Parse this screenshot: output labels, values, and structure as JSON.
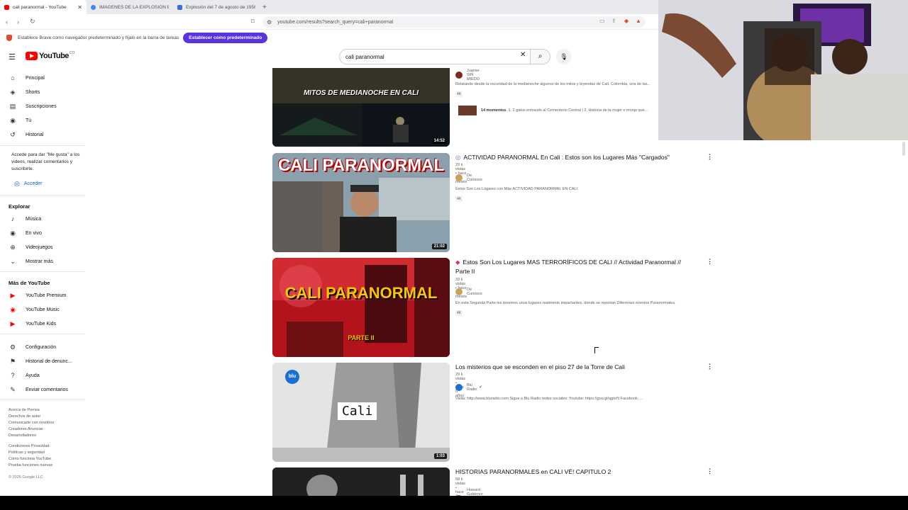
{
  "browser": {
    "tabs": [
      {
        "label": "cali paranormal - YouTube",
        "favicon_color": "#ff0000",
        "active": true
      },
      {
        "label": "IMAGENES DE LA EXPLOSIÓN EN CA...",
        "favicon_color": "#4285f4",
        "active": false
      },
      {
        "label": "Explosión del 7 de agosto de 1956 e...",
        "favicon_color": "#3b6fd8",
        "active": false
      }
    ],
    "url": "youtube.com/results?search_query=cali+paranormal",
    "notification": {
      "text": "Establece Brave como navegador predeterminado y fíjalo en la barra de tareas",
      "button": "Establecer como predeterminado"
    }
  },
  "youtube": {
    "logo": "YouTube",
    "country": "CO",
    "search_value": "cali paranormal",
    "sidebar": {
      "main": [
        {
          "label": "Principal",
          "icon": "home-icon"
        },
        {
          "label": "Shorts",
          "icon": "shorts-icon"
        },
        {
          "label": "Suscripciones",
          "icon": "subscriptions-icon"
        },
        {
          "label": "Tú",
          "icon": "you-icon"
        },
        {
          "label": "Historial",
          "icon": "history-icon"
        }
      ],
      "login_prompt": "Accede para dar \"Me gusta\" a los videos, realizar comentarios y suscribirte.",
      "login_button": "Acceder",
      "explore_title": "Explorar",
      "explore": [
        {
          "label": "Música",
          "icon": "music-icon"
        },
        {
          "label": "En vivo",
          "icon": "live-icon"
        },
        {
          "label": "Videojuegos",
          "icon": "gaming-icon"
        },
        {
          "label": "Mostrar más",
          "icon": "chevron-down-icon"
        }
      ],
      "more_title": "Más de YouTube",
      "more": [
        {
          "label": "YouTube Premium",
          "icon": "youtube-premium-icon"
        },
        {
          "label": "YouTube Music",
          "icon": "youtube-music-icon"
        },
        {
          "label": "YouTube Kids",
          "icon": "youtube-kids-icon"
        }
      ],
      "settings": [
        {
          "label": "Configuración",
          "icon": "gear-icon"
        },
        {
          "label": "Historial de denunc...",
          "icon": "flag-icon"
        },
        {
          "label": "Ayuda",
          "icon": "help-icon"
        },
        {
          "label": "Enviar comentarios",
          "icon": "feedback-icon"
        }
      ],
      "footer1": [
        "Acerca de  Prensa",
        "Derechos de autor",
        "Comunicarte con nosotros",
        "Creadores  Anunciar",
        "Desarrolladores"
      ],
      "footer2": [
        "Condiciones  Privacidad",
        "Políticas y seguridad",
        "Cómo funciona YouTube",
        "Prueba funciones nuevas"
      ],
      "copyright": "© 2025 Google LLC"
    },
    "results": [
      {
        "title": "",
        "channel": "Juanse SIN MIEDO",
        "description": "Relatando desde la oscuridad de la medianoche algunos de los mitos y leyendas de Cali, Colombia, una de las...",
        "badge": "4K",
        "duration": "14:52",
        "thumb_text": "MITOS DE MEDIANOCHE EN CALI",
        "moments_count": "14 momentos",
        "moments_text": "1. 2 gatos entrando al Cementerio Central | 2. Historia de la mujer o monja que..."
      },
      {
        "title": "ACTIVIDAD PARANORMAL En Cali : Estos son los Lugares Más \"Cargados\"",
        "meta": "29 k vistas • hace 11 meses",
        "channel": "De Curiosos",
        "description": "Estos Son Los Lugares con Más ACTIVIDAD PARANORMAL EN CALI",
        "badge": "4K",
        "duration": "21:02",
        "thumb_text": "CALI PARANORMAL"
      },
      {
        "title": "Estos Son Los Lugares MAS TERRORÍFICOS DE CALI // Actividad Paranormal // Parte II",
        "meta": "33 k vistas • hace 11 meses",
        "channel": "De Curiosos",
        "description": "En esta Segunda Parte les tenemos unos lugares realmente impactantes, donde se reportan Diferentes eventos Paranormales.",
        "badge": "4K",
        "duration": "",
        "thumb_text": "CALI PARANORMAL",
        "thumb_sub": "PARTE II"
      },
      {
        "title": "Los misterios que se esconden en el piso 27 de la Torre de Cali",
        "meta": "29 k vistas • hace 6 años",
        "channel": "Blu Radio",
        "description": "Visita: http://www.bluradio.com Sigue a Blu Radio redes sociales: Youtube: https://goo.gl/qgorN Facebook: ...",
        "duration": "1:03",
        "thumb_text": "Cali"
      },
      {
        "title": "HISTORIAS PARANORMALES en CALI VÉ! CAPITULO 2",
        "meta": "58 k vistas • hace 3 años",
        "channel": "Howard Gutiérrez / Conexión Fantasma",
        "duration": ""
      }
    ]
  },
  "colors": {
    "brand": "#ff0000",
    "brave_button": "#5a32e0",
    "link": "#065fd4"
  }
}
